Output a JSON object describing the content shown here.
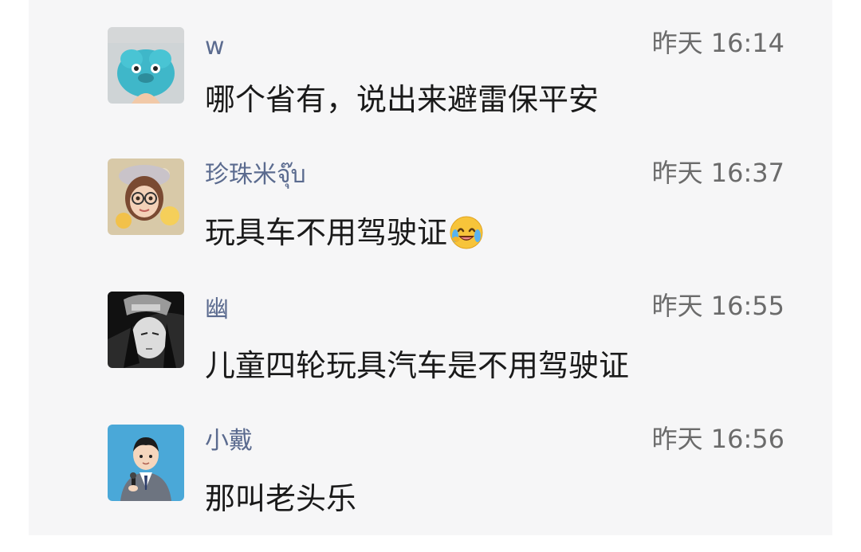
{
  "comments": [
    {
      "username": "w",
      "time": "昨天 16:14",
      "text": "哪个省有，说出来避雷保平安",
      "avatar_icon": "blue-furry-monster-avatar"
    },
    {
      "username": "珍珠米จุ๊บ",
      "time": "昨天 16:37",
      "text": "玩具车不用驾驶证",
      "emoji_icon": "laughing-tears-emoji",
      "avatar_icon": "girl-with-glasses-avatar"
    },
    {
      "username": "幽",
      "time": "昨天 16:55",
      "text": "儿童四轮玩具汽车是不用驾驶证",
      "avatar_icon": "dark-anime-character-avatar"
    },
    {
      "username": "小戴",
      "time": "昨天 16:56",
      "text": "那叫老头乐",
      "avatar_icon": "cartoon-reporter-avatar"
    }
  ],
  "colors": {
    "panel_background": "#f6f6f7",
    "username": "#5b6b8f",
    "timestamp": "#6b6b6b",
    "message_text": "#1a1a1a"
  }
}
